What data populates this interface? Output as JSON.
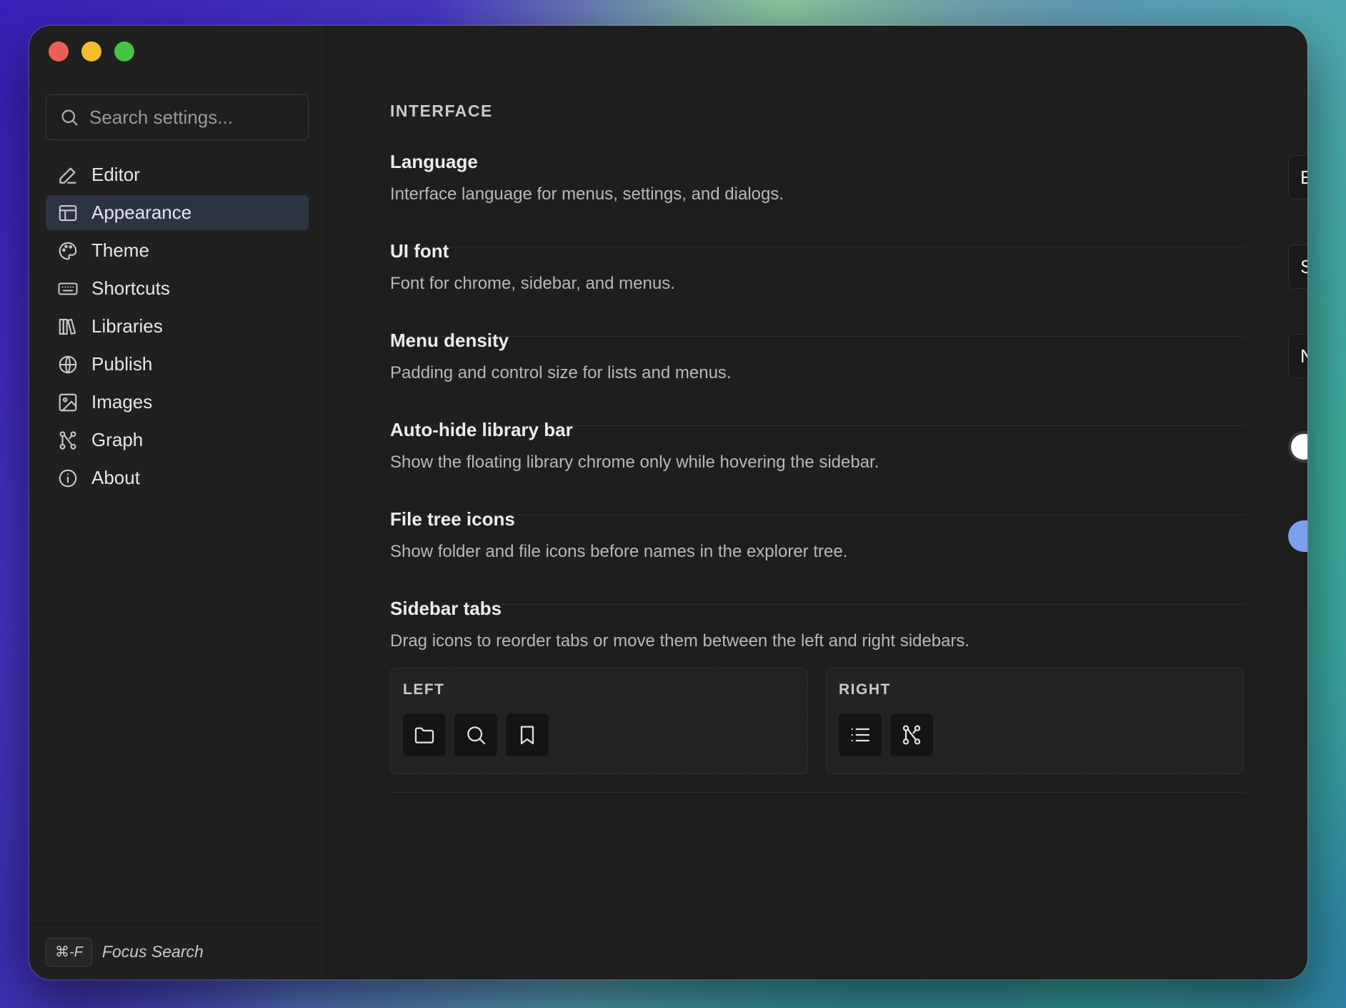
{
  "sidebar": {
    "search": {
      "placeholder": "Search settings..."
    },
    "items": [
      {
        "label": "Editor",
        "icon": "pencil-icon"
      },
      {
        "label": "Appearance",
        "icon": "layout-icon",
        "active": true
      },
      {
        "label": "Theme",
        "icon": "palette-icon"
      },
      {
        "label": "Shortcuts",
        "icon": "keyboard-icon"
      },
      {
        "label": "Libraries",
        "icon": "library-icon"
      },
      {
        "label": "Publish",
        "icon": "globe-icon"
      },
      {
        "label": "Images",
        "icon": "image-icon"
      },
      {
        "label": "Graph",
        "icon": "graph-icon"
      },
      {
        "label": "About",
        "icon": "info-icon"
      }
    ],
    "footer": {
      "kbd": "⌘-F",
      "label": "Focus Search"
    }
  },
  "main": {
    "section_title": "INTERFACE",
    "language": {
      "title": "Language",
      "desc": "Interface language for menus, settings, and dialogs.",
      "value": "English"
    },
    "ui_font": {
      "title": "UI font",
      "desc": "Font for chrome, sidebar, and menus.",
      "value": "System default"
    },
    "menu_density": {
      "title": "Menu density",
      "desc": "Padding and control size for lists and menus.",
      "value": "Normal"
    },
    "auto_hide": {
      "title": "Auto-hide library bar",
      "desc": "Show the floating library chrome only while hovering the sidebar.",
      "enabled": false
    },
    "file_tree_icons": {
      "title": "File tree icons",
      "desc": "Show folder and file icons before names in the explorer tree.",
      "enabled": true
    },
    "sidebar_tabs": {
      "title": "Sidebar tabs",
      "desc": "Drag icons to reorder tabs or move them between the left and right sidebars.",
      "left": {
        "label": "LEFT",
        "icons": [
          "folder-icon",
          "search-icon",
          "bookmark-icon"
        ]
      },
      "right": {
        "label": "RIGHT",
        "icons": [
          "list-icon",
          "graph-icon"
        ]
      }
    }
  },
  "colors": {
    "window_bg": "#1e1e1e",
    "active_nav": "#2c3444",
    "toggle_on": "#7b9ff0",
    "toggle_off": "#3a3a3a",
    "traffic_red": "#ec5f57",
    "traffic_yellow": "#f3bd2f",
    "traffic_green": "#45c342"
  }
}
